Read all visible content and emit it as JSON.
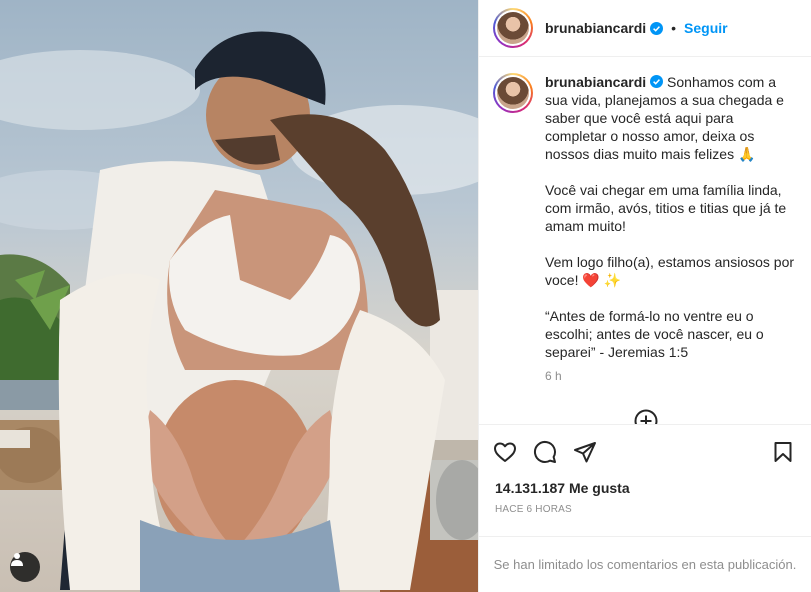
{
  "post": {
    "username": "brunabiancardi",
    "follow_label": "Seguir",
    "separator": "•",
    "caption": {
      "username": "brunabiancardi",
      "paragraphs": [
        "Sonhamos com a sua vida, planejamos a sua chegada e saber que você está aqui para completar o nosso amor, deixa os nossos dias muito mais felizes 🙏",
        "Você vai chegar em uma família linda, com irmão, avós, titios e titias que já te amam muito!",
        "Vem logo filho(a), estamos ansiosos por voce! ❤️ ✨",
        "“Antes de formá-lo no ventre eu o escolhi; antes de você nascer, eu o separei” - Jeremias 1:5"
      ],
      "time_ago": "6 h"
    },
    "likes_text": "14.131.187 Me gusta",
    "date_text": "HACE 6 HORAS",
    "comments_limited": "Se han limitado los comentarios en esta publicación.",
    "icons": {
      "verified": "verified-badge-icon",
      "load_more": "plus-circle-icon",
      "like": "heart-icon",
      "comment": "comment-bubble-icon",
      "share": "paper-plane-icon",
      "save": "bookmark-icon",
      "tags": "user-tag-icon"
    },
    "colors": {
      "accent": "#0095f6",
      "verified": "#0095f6",
      "muted": "#8e8e8e"
    }
  }
}
